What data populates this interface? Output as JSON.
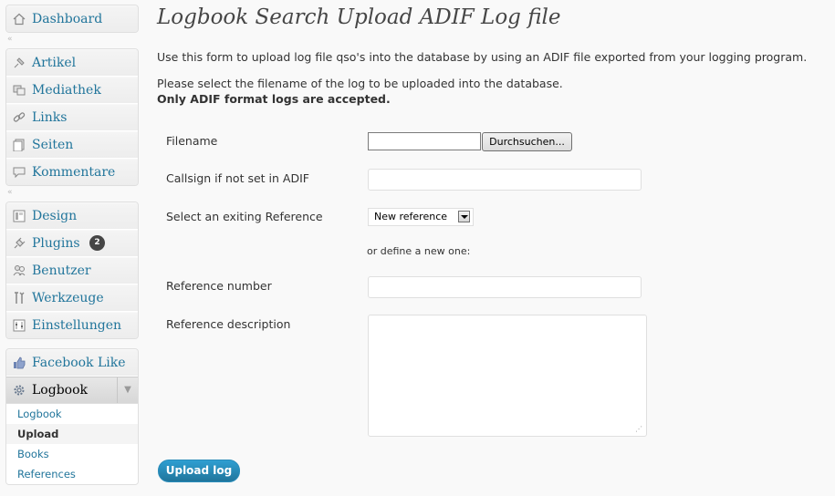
{
  "sidebar": {
    "dashboard": {
      "label": "Dashboard"
    },
    "group1": [
      {
        "label": "Artikel",
        "icon": "pin-icon"
      },
      {
        "label": "Mediathek",
        "icon": "media-icon"
      },
      {
        "label": "Links",
        "icon": "link-icon"
      },
      {
        "label": "Seiten",
        "icon": "pages-icon"
      },
      {
        "label": "Kommentare",
        "icon": "comment-icon"
      }
    ],
    "group2": [
      {
        "label": "Design",
        "icon": "design-icon"
      },
      {
        "label": "Plugins",
        "icon": "plugin-icon",
        "badge": "2"
      },
      {
        "label": "Benutzer",
        "icon": "users-icon"
      },
      {
        "label": "Werkzeuge",
        "icon": "tools-icon"
      },
      {
        "label": "Einstellungen",
        "icon": "settings-icon"
      }
    ],
    "facebook_like": {
      "label": "Facebook Like"
    },
    "logbook": {
      "label": "Logbook",
      "submenu": [
        {
          "label": "Logbook"
        },
        {
          "label": "Upload",
          "current": true
        },
        {
          "label": "Books"
        },
        {
          "label": "References"
        }
      ]
    },
    "collapse_glyph": "«"
  },
  "main": {
    "title": "Logbook Search Upload ADIF Log file",
    "intro": "Use this form to upload log file qso's into the database by using an ADIF file exported from your logging program.",
    "p2": "Please select the filename of the log to be uploaded into the database.",
    "p3": "Only ADIF format logs are accepted.",
    "form": {
      "filename_label": "Filename",
      "browse_label": "Durchsuchen...",
      "callsign_label": "Callsign if not set in ADIF",
      "reference_label": "Select an exiting Reference",
      "reference_selected": "New reference",
      "define_new": "or define a new one:",
      "ref_number_label": "Reference number",
      "ref_desc_label": "Reference description",
      "submit_label": "Upload log"
    }
  },
  "colors": {
    "link": "#21759b",
    "button": "#21759b",
    "background": "#f9f9f9"
  }
}
